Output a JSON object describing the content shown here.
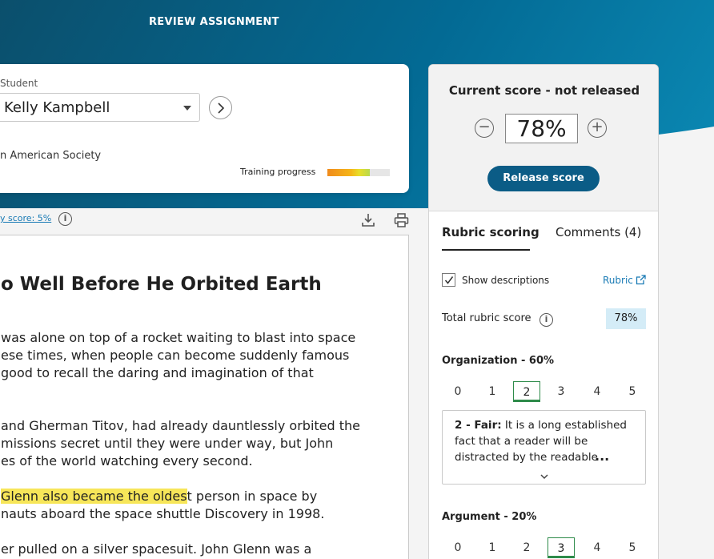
{
  "header": {
    "title": "REVIEW ASSIGNMENT"
  },
  "student": {
    "label": "Student",
    "selected": "Kelly Kampbell",
    "course": "n American Society",
    "training_label": "Training progress",
    "training_progress": 0.68
  },
  "toolbar": {
    "similarity": "y score: 5%",
    "info_icon": "i"
  },
  "document": {
    "title": "o Well Before He Orbited Earth",
    "paragraphs": [
      [
        "was alone on top of a rocket waiting to blast into space",
        "ese times, when people can become suddenly famous",
        "good to recall the daring and imagination of that"
      ],
      [
        "and Gherman Titov, had already dauntlessly orbited the",
        "missions secret until they were under way, but John",
        "es of the world watching every second."
      ],
      {
        "highlight": "Glenn also became the oldes",
        "rest": "t person in space by",
        "line2": "nauts aboard the space shuttle Discovery in 1998."
      },
      [
        "er pulled on a silver spacesuit. John Glenn was a"
      ]
    ]
  },
  "score": {
    "title": "Current score - not released",
    "value": "78%",
    "minus": "−",
    "plus": "+",
    "release_label": "Release score"
  },
  "tabs": [
    {
      "label": "Rubric scoring",
      "active": true
    },
    {
      "label": "Comments (4)",
      "active": false
    }
  ],
  "rubric": {
    "show_descriptions": "Show descriptions",
    "link_label": "Rubric",
    "total_label": "Total rubric score",
    "total_value": "78%",
    "criteria": [
      {
        "title": "Organization - 60%",
        "levels": [
          "0",
          "1",
          "2",
          "3",
          "4",
          "5"
        ],
        "selected": "2",
        "desc_label": "2 - Fair:",
        "desc_text": "It is a long established fact that a reader will be distracted by the readable",
        "ellipsis": "..."
      },
      {
        "title": "Argument - 20%",
        "levels": [
          "0",
          "1",
          "2",
          "3",
          "4",
          "5"
        ],
        "selected": "3"
      }
    ]
  },
  "colors": {
    "accent": "#0b5c86",
    "link": "#1a7bb5",
    "selected_level": "#2e8b4a",
    "highlight": "#f7e659",
    "badge": "#d4ecf7"
  }
}
